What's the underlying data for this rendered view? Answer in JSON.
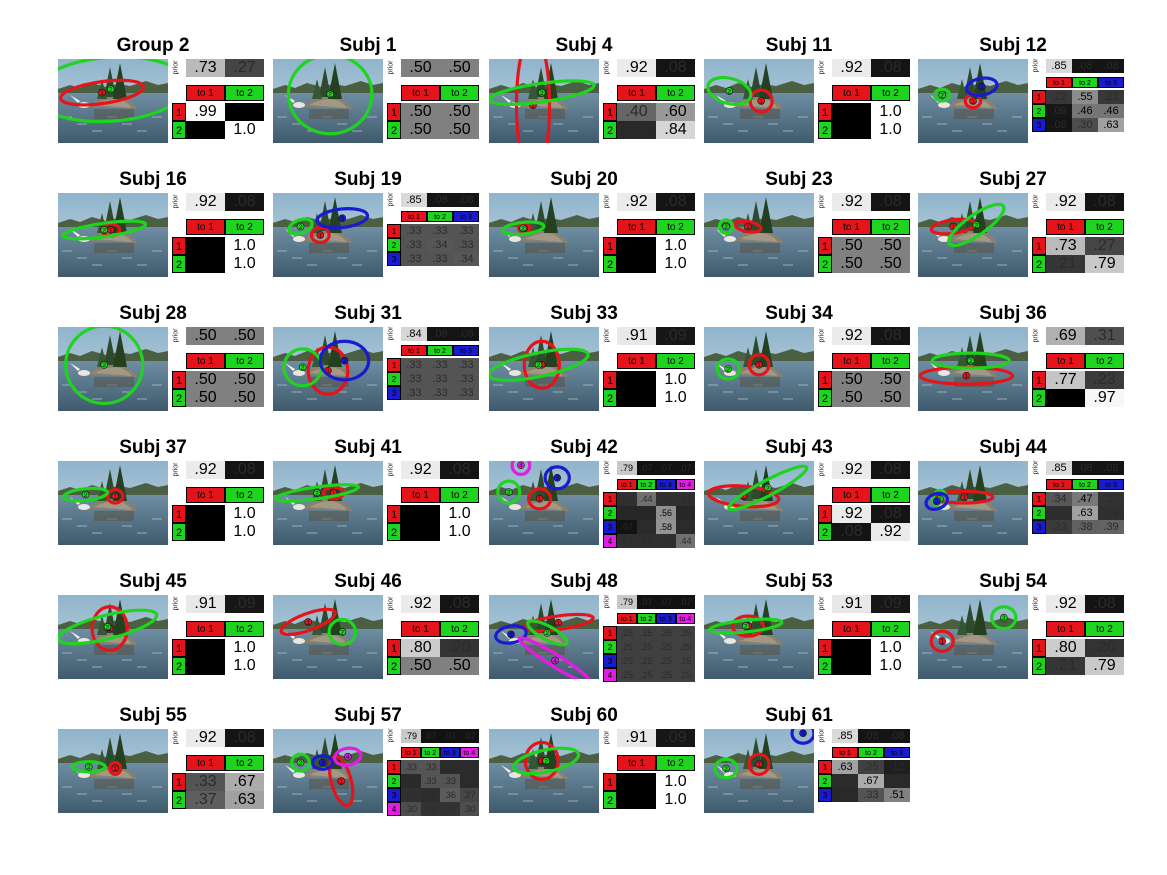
{
  "color_legend": {
    "1": "#e5141a",
    "2": "#1ed41e",
    "3": "#1a1ad0",
    "4": "#e21de2"
  },
  "labels": {
    "prior": "prior",
    "to": [
      "to 1",
      "to 2",
      "to 3",
      "to 4"
    ]
  },
  "chart_data": [
    {
      "type": "table",
      "title": "Group 2",
      "k": 2,
      "prior": [
        ".73",
        ".27"
      ],
      "trans": [
        [
          ".99",
          ""
        ],
        [
          "",
          "1.0"
        ]
      ],
      "ellipses": [
        {
          "c": 1,
          "cx": 0.4,
          "cy": 0.4,
          "rx": 0.38,
          "ry": 0.13,
          "a": -8
        },
        {
          "c": 2,
          "cx": 0.48,
          "cy": 0.36,
          "rx": 0.7,
          "ry": 0.38,
          "a": -4
        }
      ]
    },
    {
      "type": "table",
      "title": "Subj 1",
      "k": 2,
      "prior": [
        ".50",
        ".50"
      ],
      "trans": [
        [
          ".50",
          ".50"
        ],
        [
          ".50",
          ".50"
        ]
      ],
      "ellipses": [
        {
          "c": 2,
          "cx": 0.52,
          "cy": 0.42,
          "rx": 0.38,
          "ry": 0.47,
          "a": 0
        }
      ]
    },
    {
      "type": "table",
      "title": "Subj 4",
      "k": 2,
      "prior": [
        ".92",
        ".08"
      ],
      "trans": [
        [
          ".40",
          ".60"
        ],
        [
          ".16",
          ".84"
        ]
      ],
      "ellipses": [
        {
          "c": 1,
          "cx": 0.4,
          "cy": 0.55,
          "rx": 0.15,
          "ry": 0.85,
          "a": 0
        },
        {
          "c": 2,
          "cx": 0.48,
          "cy": 0.4,
          "rx": 0.48,
          "ry": 0.11,
          "a": -8
        }
      ]
    },
    {
      "type": "table",
      "title": "Subj 11",
      "k": 2,
      "prior": [
        ".92",
        ".08"
      ],
      "trans": [
        [
          "",
          "1.0"
        ],
        [
          "",
          "1.0"
        ]
      ],
      "ellipses": [
        {
          "c": 1,
          "cx": 0.52,
          "cy": 0.5,
          "rx": 0.1,
          "ry": 0.13,
          "a": 0
        },
        {
          "c": 2,
          "cx": 0.23,
          "cy": 0.38,
          "rx": 0.2,
          "ry": 0.15,
          "a": 15
        }
      ]
    },
    {
      "type": "table",
      "title": "Subj 12",
      "k": 3,
      "prior": [
        ".85",
        ".08",
        ".08"
      ],
      "trans": [
        [
          ".22",
          ".55",
          ".22"
        ],
        [
          ".09",
          ".46",
          ".46"
        ],
        [
          ".08",
          ".30",
          ".63"
        ]
      ],
      "ellipses": [
        {
          "c": 1,
          "cx": 0.5,
          "cy": 0.5,
          "rx": 0.07,
          "ry": 0.08,
          "a": 0
        },
        {
          "c": 3,
          "cx": 0.58,
          "cy": 0.33,
          "rx": 0.14,
          "ry": 0.1,
          "a": -10
        },
        {
          "c": 2,
          "cx": 0.22,
          "cy": 0.43,
          "rx": 0.07,
          "ry": 0.07,
          "a": 0
        }
      ]
    },
    {
      "type": "table",
      "title": "Subj 16",
      "k": 2,
      "prior": [
        ".92",
        ".08"
      ],
      "trans": [
        [
          "",
          "1.0"
        ],
        [
          "",
          "1.0"
        ]
      ],
      "ellipses": [
        {
          "c": 1,
          "cx": 0.48,
          "cy": 0.44,
          "rx": 0.08,
          "ry": 0.07,
          "a": 0
        },
        {
          "c": 2,
          "cx": 0.42,
          "cy": 0.44,
          "rx": 0.38,
          "ry": 0.08,
          "a": -8
        }
      ]
    },
    {
      "type": "table",
      "title": "Subj 19",
      "k": 3,
      "prior": [
        ".85",
        ".08",
        ".08"
      ],
      "trans": [
        [
          ".33",
          ".33",
          ".33"
        ],
        [
          ".33",
          ".34",
          ".33"
        ],
        [
          ".33",
          ".33",
          ".34"
        ]
      ],
      "ellipses": [
        {
          "c": 1,
          "cx": 0.43,
          "cy": 0.5,
          "rx": 0.08,
          "ry": 0.09,
          "a": 0
        },
        {
          "c": 3,
          "cx": 0.63,
          "cy": 0.3,
          "rx": 0.23,
          "ry": 0.11,
          "a": -6
        },
        {
          "c": 2,
          "cx": 0.25,
          "cy": 0.4,
          "rx": 0.11,
          "ry": 0.08,
          "a": -20
        }
      ]
    },
    {
      "type": "table",
      "title": "Subj 20",
      "k": 2,
      "prior": [
        ".92",
        ".08"
      ],
      "trans": [
        [
          "",
          "1.0"
        ],
        [
          "",
          "1.0"
        ]
      ],
      "ellipses": [
        {
          "c": 1,
          "cx": 0.32,
          "cy": 0.42,
          "rx": 0.05,
          "ry": 0.05,
          "a": 0
        },
        {
          "c": 2,
          "cx": 0.31,
          "cy": 0.42,
          "rx": 0.19,
          "ry": 0.07,
          "a": -6
        }
      ]
    },
    {
      "type": "table",
      "title": "Subj 23",
      "k": 2,
      "prior": [
        ".92",
        ".08"
      ],
      "trans": [
        [
          ".50",
          ".50"
        ],
        [
          ".50",
          ".50"
        ]
      ],
      "ellipses": [
        {
          "c": 1,
          "cx": 0.4,
          "cy": 0.4,
          "rx": 0.12,
          "ry": 0.06,
          "a": 10
        },
        {
          "c": 2,
          "cx": 0.2,
          "cy": 0.4,
          "rx": 0.06,
          "ry": 0.08,
          "a": 0
        }
      ]
    },
    {
      "type": "table",
      "title": "Subj 27",
      "k": 2,
      "prior": [
        ".92",
        ".08"
      ],
      "trans": [
        [
          ".73",
          ".27"
        ],
        [
          ".21",
          ".79"
        ]
      ],
      "ellipses": [
        {
          "c": 1,
          "cx": 0.32,
          "cy": 0.4,
          "rx": 0.2,
          "ry": 0.08,
          "a": -8
        },
        {
          "c": 2,
          "cx": 0.53,
          "cy": 0.38,
          "rx": 0.3,
          "ry": 0.12,
          "a": -35
        }
      ]
    },
    {
      "type": "table",
      "title": "Subj 28",
      "k": 2,
      "prior": [
        ".50",
        ".50"
      ],
      "trans": [
        [
          ".50",
          ".50"
        ],
        [
          ".50",
          ".50"
        ]
      ],
      "ellipses": [
        {
          "c": 2,
          "cx": 0.42,
          "cy": 0.45,
          "rx": 0.35,
          "ry": 0.46,
          "a": 0
        }
      ]
    },
    {
      "type": "table",
      "title": "Subj 31",
      "k": 3,
      "prior": [
        ".84",
        ".08",
        ".08"
      ],
      "trans": [
        [
          ".33",
          ".33",
          ".33"
        ],
        [
          ".33",
          ".33",
          ".33"
        ],
        [
          ".33",
          ".33",
          ".33"
        ]
      ],
      "ellipses": [
        {
          "c": 1,
          "cx": 0.5,
          "cy": 0.52,
          "rx": 0.18,
          "ry": 0.28,
          "a": 0
        },
        {
          "c": 2,
          "cx": 0.27,
          "cy": 0.48,
          "rx": 0.17,
          "ry": 0.22,
          "a": 0
        },
        {
          "c": 3,
          "cx": 0.65,
          "cy": 0.4,
          "rx": 0.22,
          "ry": 0.23,
          "a": 0
        }
      ]
    },
    {
      "type": "table",
      "title": "Subj 33",
      "k": 2,
      "prior": [
        ".91",
        ".09"
      ],
      "trans": [
        [
          "",
          "1.0"
        ],
        [
          "",
          "1.0"
        ]
      ],
      "ellipses": [
        {
          "c": 1,
          "cx": 0.48,
          "cy": 0.45,
          "rx": 0.16,
          "ry": 0.28,
          "a": 0
        },
        {
          "c": 2,
          "cx": 0.45,
          "cy": 0.45,
          "rx": 0.46,
          "ry": 0.14,
          "a": -12
        }
      ]
    },
    {
      "type": "table",
      "title": "Subj 34",
      "k": 2,
      "prior": [
        ".92",
        ".08"
      ],
      "trans": [
        [
          ".50",
          ".50"
        ],
        [
          ".50",
          ".50"
        ]
      ],
      "ellipses": [
        {
          "c": 1,
          "cx": 0.5,
          "cy": 0.45,
          "rx": 0.09,
          "ry": 0.12,
          "a": 0
        },
        {
          "c": 2,
          "cx": 0.22,
          "cy": 0.5,
          "rx": 0.1,
          "ry": 0.12,
          "a": 0
        }
      ]
    },
    {
      "type": "table",
      "title": "Subj 36",
      "k": 2,
      "prior": [
        ".69",
        ".31"
      ],
      "trans": [
        [
          ".77",
          ".23"
        ],
        [
          "",
          ".97"
        ]
      ],
      "ellipses": [
        {
          "c": 1,
          "cx": 0.44,
          "cy": 0.58,
          "rx": 0.42,
          "ry": 0.1,
          "a": 0
        },
        {
          "c": 2,
          "cx": 0.48,
          "cy": 0.4,
          "rx": 0.35,
          "ry": 0.09,
          "a": 0
        }
      ]
    },
    {
      "type": "table",
      "title": "Subj 37",
      "k": 2,
      "prior": [
        ".92",
        ".08"
      ],
      "trans": [
        [
          "",
          "1.0"
        ],
        [
          "",
          "1.0"
        ]
      ],
      "ellipses": [
        {
          "c": 1,
          "cx": 0.52,
          "cy": 0.42,
          "rx": 0.07,
          "ry": 0.08,
          "a": 0
        },
        {
          "c": 2,
          "cx": 0.25,
          "cy": 0.4,
          "rx": 0.2,
          "ry": 0.07,
          "a": -6
        }
      ]
    },
    {
      "type": "table",
      "title": "Subj 41",
      "k": 2,
      "prior": [
        ".92",
        ".08"
      ],
      "trans": [
        [
          "",
          "1.0"
        ],
        [
          "",
          "1.0"
        ]
      ],
      "ellipses": [
        {
          "c": 1,
          "cx": 0.55,
          "cy": 0.38,
          "rx": 0.09,
          "ry": 0.07,
          "a": 0
        },
        {
          "c": 2,
          "cx": 0.4,
          "cy": 0.38,
          "rx": 0.38,
          "ry": 0.07,
          "a": -8
        }
      ]
    },
    {
      "type": "table",
      "title": "Subj 42",
      "k": 4,
      "prior": [
        ".79",
        ".07",
        ".07",
        ".07"
      ],
      "trans": [
        [
          ".19",
          ".44",
          ".19",
          ".19"
        ],
        [
          ".15",
          ".15",
          ".56",
          ".15"
        ],
        [
          ".07",
          ".17",
          ".58",
          ".17"
        ],
        [
          ".19",
          ".19",
          ".19",
          ".44"
        ]
      ],
      "ellipses": [
        {
          "c": 1,
          "cx": 0.46,
          "cy": 0.45,
          "rx": 0.1,
          "ry": 0.12,
          "a": 0
        },
        {
          "c": 2,
          "cx": 0.18,
          "cy": 0.37,
          "rx": 0.1,
          "ry": 0.13,
          "a": 0
        },
        {
          "c": 3,
          "cx": 0.62,
          "cy": 0.2,
          "rx": 0.11,
          "ry": 0.13,
          "a": 0
        },
        {
          "c": 4,
          "cx": 0.29,
          "cy": 0.05,
          "rx": 0.08,
          "ry": 0.11,
          "a": 0
        }
      ]
    },
    {
      "type": "table",
      "title": "Subj 43",
      "k": 2,
      "prior": [
        ".92",
        ".08"
      ],
      "trans": [
        [
          ".92",
          ".08"
        ],
        [
          ".08",
          ".92"
        ]
      ],
      "ellipses": [
        {
          "c": 1,
          "cx": 0.36,
          "cy": 0.42,
          "rx": 0.32,
          "ry": 0.12,
          "a": 5
        },
        {
          "c": 2,
          "cx": 0.58,
          "cy": 0.32,
          "rx": 0.4,
          "ry": 0.09,
          "a": -28
        }
      ]
    },
    {
      "type": "table",
      "title": "Subj 44",
      "k": 3,
      "prior": [
        ".85",
        ".08",
        ".08"
      ],
      "trans": [
        [
          ".34",
          ".47",
          ".20"
        ],
        [
          ".18",
          ".63",
          ".19"
        ],
        [
          ".23",
          ".38",
          ".39"
        ]
      ],
      "ellipses": [
        {
          "c": 1,
          "cx": 0.42,
          "cy": 0.43,
          "rx": 0.26,
          "ry": 0.07,
          "a": 0
        },
        {
          "c": 2,
          "cx": 0.2,
          "cy": 0.45,
          "rx": 0.06,
          "ry": 0.1,
          "a": 0
        },
        {
          "c": 3,
          "cx": 0.17,
          "cy": 0.48,
          "rx": 0.1,
          "ry": 0.09,
          "a": -20
        }
      ]
    },
    {
      "type": "table",
      "title": "Subj 45",
      "k": 2,
      "prior": [
        ".91",
        ".09"
      ],
      "trans": [
        [
          "",
          "1.0"
        ],
        [
          "",
          "1.0"
        ]
      ],
      "ellipses": [
        {
          "c": 1,
          "cx": 0.47,
          "cy": 0.4,
          "rx": 0.16,
          "ry": 0.26,
          "a": 0
        },
        {
          "c": 2,
          "cx": 0.45,
          "cy": 0.38,
          "rx": 0.46,
          "ry": 0.14,
          "a": -14
        }
      ]
    },
    {
      "type": "table",
      "title": "Subj 46",
      "k": 2,
      "prior": [
        ".92",
        ".08"
      ],
      "trans": [
        [
          ".80",
          ".20"
        ],
        [
          ".50",
          ".50"
        ]
      ],
      "ellipses": [
        {
          "c": 1,
          "cx": 0.32,
          "cy": 0.32,
          "rx": 0.26,
          "ry": 0.1,
          "a": -20
        },
        {
          "c": 2,
          "cx": 0.63,
          "cy": 0.44,
          "rx": 0.12,
          "ry": 0.15,
          "a": 0
        }
      ]
    },
    {
      "type": "table",
      "title": "Subj 48",
      "k": 4,
      "prior": [
        ".79",
        ".07",
        ".07",
        ".07"
      ],
      "trans": [
        [
          ".25",
          ".25",
          ".25",
          ".25"
        ],
        [
          ".25",
          ".25",
          ".25",
          ".25"
        ],
        [
          ".25",
          ".25",
          ".25",
          ".25"
        ],
        [
          ".25",
          ".25",
          ".25",
          ".25"
        ]
      ],
      "ellipses": [
        {
          "c": 1,
          "cx": 0.63,
          "cy": 0.33,
          "rx": 0.32,
          "ry": 0.08,
          "a": -8
        },
        {
          "c": 2,
          "cx": 0.53,
          "cy": 0.45,
          "rx": 0.2,
          "ry": 0.08,
          "a": 28
        },
        {
          "c": 3,
          "cx": 0.2,
          "cy": 0.47,
          "rx": 0.14,
          "ry": 0.1,
          "a": -10
        },
        {
          "c": 4,
          "cx": 0.6,
          "cy": 0.78,
          "rx": 0.38,
          "ry": 0.07,
          "a": 32
        }
      ]
    },
    {
      "type": "table",
      "title": "Subj 53",
      "k": 2,
      "prior": [
        ".91",
        ".09"
      ],
      "trans": [
        [
          "",
          "1.0"
        ],
        [
          "",
          "1.0"
        ]
      ],
      "ellipses": [
        {
          "c": 1,
          "cx": 0.4,
          "cy": 0.37,
          "rx": 0.14,
          "ry": 0.12,
          "a": 0
        },
        {
          "c": 2,
          "cx": 0.38,
          "cy": 0.37,
          "rx": 0.33,
          "ry": 0.07,
          "a": -6
        }
      ]
    },
    {
      "type": "table",
      "title": "Subj 54",
      "k": 2,
      "prior": [
        ".92",
        ".08"
      ],
      "trans": [
        [
          ".80",
          ".20"
        ],
        [
          ".21",
          ".79"
        ]
      ],
      "ellipses": [
        {
          "c": 1,
          "cx": 0.22,
          "cy": 0.55,
          "rx": 0.1,
          "ry": 0.12,
          "a": 0
        },
        {
          "c": 2,
          "cx": 0.78,
          "cy": 0.27,
          "rx": 0.11,
          "ry": 0.13,
          "a": 0
        }
      ]
    },
    {
      "type": "table",
      "title": "Subj 55",
      "k": 2,
      "prior": [
        ".92",
        ".08"
      ],
      "trans": [
        [
          ".33",
          ".67"
        ],
        [
          ".37",
          ".63"
        ]
      ],
      "ellipses": [
        {
          "c": 1,
          "cx": 0.52,
          "cy": 0.47,
          "rx": 0.05,
          "ry": 0.07,
          "a": 0
        },
        {
          "c": 2,
          "cx": 0.28,
          "cy": 0.45,
          "rx": 0.15,
          "ry": 0.06,
          "a": 0
        }
      ]
    },
    {
      "type": "table",
      "title": "Subj 57",
      "k": 4,
      "prior": [
        ".79",
        ".07",
        ".07",
        ".07"
      ],
      "trans": [
        [
          ".33",
          ".33",
          ".17",
          ".17"
        ],
        [
          ".17",
          ".33",
          ".33",
          ".17"
        ],
        [
          ".19",
          ".18",
          ".36",
          ".27"
        ],
        [
          ".30",
          ".20",
          ".20",
          ".30"
        ]
      ],
      "ellipses": [
        {
          "c": 1,
          "cx": 0.62,
          "cy": 0.62,
          "rx": 0.09,
          "ry": 0.3,
          "a": -15
        },
        {
          "c": 2,
          "cx": 0.25,
          "cy": 0.4,
          "rx": 0.08,
          "ry": 0.1,
          "a": 0
        },
        {
          "c": 3,
          "cx": 0.45,
          "cy": 0.4,
          "rx": 0.09,
          "ry": 0.08,
          "a": 0
        },
        {
          "c": 4,
          "cx": 0.68,
          "cy": 0.33,
          "rx": 0.12,
          "ry": 0.1,
          "a": -10
        }
      ]
    },
    {
      "type": "table",
      "title": "Subj 60",
      "k": 2,
      "prior": [
        ".91",
        ".09"
      ],
      "trans": [
        [
          "",
          "1.0"
        ],
        [
          "",
          "1.0"
        ]
      ],
      "ellipses": [
        {
          "c": 1,
          "cx": 0.48,
          "cy": 0.38,
          "rx": 0.15,
          "ry": 0.22,
          "a": 0
        },
        {
          "c": 2,
          "cx": 0.52,
          "cy": 0.38,
          "rx": 0.3,
          "ry": 0.13,
          "a": -12
        }
      ]
    },
    {
      "type": "table",
      "title": "Subj 61",
      "k": 3,
      "prior": [
        ".85",
        ".08",
        ".08"
      ],
      "trans": [
        [
          ".63",
          ".25",
          ".12"
        ],
        [
          ".17",
          ".67",
          ".16"
        ],
        [
          ".16",
          ".33",
          ".51"
        ]
      ],
      "ellipses": [
        {
          "c": 1,
          "cx": 0.5,
          "cy": 0.42,
          "rx": 0.09,
          "ry": 0.12,
          "a": 0
        },
        {
          "c": 2,
          "cx": 0.2,
          "cy": 0.47,
          "rx": 0.1,
          "ry": 0.11,
          "a": 0
        },
        {
          "c": 3,
          "cx": 0.9,
          "cy": 0.05,
          "rx": 0.1,
          "ry": 0.12,
          "a": 0
        }
      ]
    }
  ]
}
